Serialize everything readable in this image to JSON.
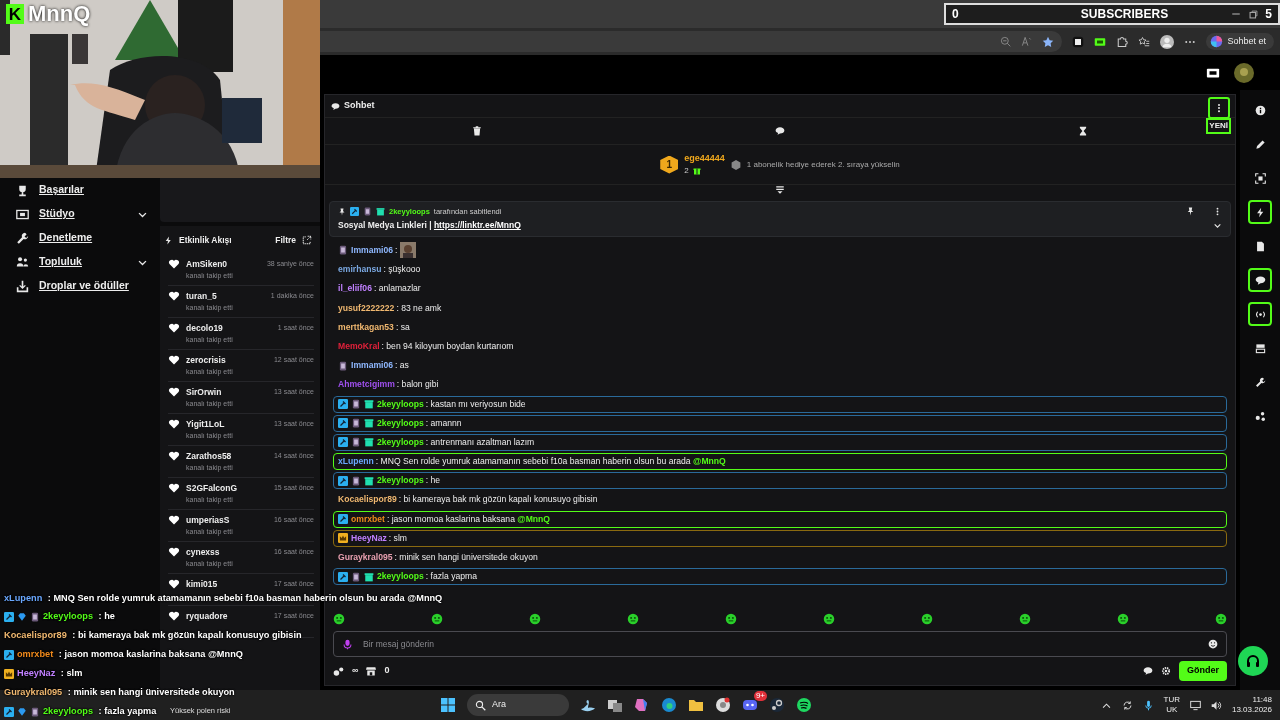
{
  "stream_overlay": {
    "logo_letter": "K",
    "channel": "MnnQ",
    "subscribers": {
      "current": "0",
      "label": "SUBSCRIBERS",
      "goal": "5"
    }
  },
  "browser": {
    "copilot_label": "Sohbet et"
  },
  "sidebar": {
    "items": [
      {
        "label": "Başarılar",
        "expandable": false
      },
      {
        "label": "Stüdyo",
        "expandable": true
      },
      {
        "label": "Denetleme",
        "expandable": false
      },
      {
        "label": "Topluluk",
        "expandable": true
      },
      {
        "label": "Droplar ve ödüller",
        "expandable": false
      }
    ]
  },
  "activity_feed": {
    "title": "Etkinlik Akışı",
    "filter_label": "Filtre",
    "events": [
      {
        "user": "AmSiken0",
        "time": "38 saniye önce",
        "action": "kanalı takip etti"
      },
      {
        "user": "turan_5",
        "time": "1 dakika önce",
        "action": "kanalı takip etti"
      },
      {
        "user": "decolo19",
        "time": "1 saat önce",
        "action": "kanalı takip etti"
      },
      {
        "user": "zerocrisis",
        "time": "12 saat önce",
        "action": "kanalı takip etti"
      },
      {
        "user": "SirOrwin",
        "time": "13 saat önce",
        "action": "kanalı takip etti"
      },
      {
        "user": "Yigit1LoL",
        "time": "13 saat önce",
        "action": "kanalı takip etti"
      },
      {
        "user": "Zarathos58",
        "time": "14 saat önce",
        "action": "kanalı takip etti"
      },
      {
        "user": "S2GFalconG",
        "time": "15 saat önce",
        "action": "kanalı takip etti"
      },
      {
        "user": "umperiasS",
        "time": "16 saat önce",
        "action": "kanalı takip etti"
      },
      {
        "user": "cynexss",
        "time": "16 saat önce",
        "action": "kanalı takip etti"
      },
      {
        "user": "kimi015",
        "time": "17 saat önce"
      },
      {
        "user": "ryquadore",
        "time": "17 saat önce"
      }
    ]
  },
  "chat": {
    "title": "Sohbet",
    "new_badge": "YENİ",
    "leaderboard": {
      "rank": "1",
      "user": "ege44444",
      "count": "2",
      "hint": "1 abonelik hediye ederek 2. sıraya yükselin"
    },
    "pinned": {
      "user": "2keyyloops",
      "by_text": "tarafından sabitlendi",
      "text": "Sosyal Medya Linkleri | ",
      "link": "https://linktr.ee/MnnQ"
    },
    "messages": [
      {
        "user": "Immami06",
        "color": "#8fb8ff",
        "text": ":",
        "kind": "emote"
      },
      {
        "user": "emirhansu",
        "color": "#7aa7e0",
        "text": ": şüşkooo",
        "kind": "plain"
      },
      {
        "user": "il_eliif06",
        "color": "#c080ff",
        "text": ": anlamazlar",
        "kind": "plain"
      },
      {
        "user": "yusuf2222222",
        "color": "#f0b870",
        "text": ": 83 ne amk",
        "kind": "plain"
      },
      {
        "user": "merttkagan53",
        "color": "#f0b870",
        "text": ": sa",
        "kind": "plain"
      },
      {
        "user": "MemoKral",
        "color": "#e0203a",
        "text": ": ben 94 kiloyum boydan kurtarıom",
        "kind": "plain"
      },
      {
        "user": "Immami06",
        "color": "#8fb8ff",
        "text": ": as",
        "kind": "member"
      },
      {
        "user": "Ahmetcigimm",
        "color": "#a050f0",
        "text": ": balon gibi",
        "kind": "plain"
      },
      {
        "user": "2keyyloops",
        "color": "#53fc18",
        "text": ": kastan mı veriyosun bide",
        "kind": "moderator"
      },
      {
        "user": "2keyyloops",
        "color": "#53fc18",
        "text": ": amannn",
        "kind": "moderator"
      },
      {
        "user": "2keyyloops",
        "color": "#53fc18",
        "text": ": antrenmanı azaltman lazım",
        "kind": "moderator"
      },
      {
        "user": "xLupenn",
        "color": "#6aa8ff",
        "text": ": MNQ Sen rolde yumruk atamamanın sebebi f10a basman haberin olsun bu arada ",
        "mention": "@MnnQ",
        "kind": "mention"
      },
      {
        "user": "2keyyloops",
        "color": "#53fc18",
        "text": ": he",
        "kind": "moderator"
      },
      {
        "user": "Kocaelispor89",
        "color": "#f0b870",
        "text": ": bi kameraya bak mk gözün kapalı konusuyo gibisin",
        "kind": "plain"
      },
      {
        "user": "omrxbet",
        "color": "#f08a1c",
        "text": ": jason momoa kaslarina baksana ",
        "mention": "@MnnQ",
        "kind": "modmention"
      },
      {
        "user": "HeeyNaz",
        "color": "#c080ff",
        "text": ": slm",
        "kind": "vip"
      },
      {
        "user": "Guraykral095",
        "color": "#e8a0b0",
        "text": ": minik sen hangi üniversitede okuyon",
        "kind": "plain"
      },
      {
        "user": "2keyyloops",
        "color": "#53fc18",
        "text": ": fazla yapma",
        "kind": "moderator"
      }
    ],
    "input": {
      "placeholder": "Bir mesaj gönderin"
    },
    "footer": {
      "points": "∞",
      "store_count": "0",
      "send_label": "Gönder"
    }
  },
  "overlay_chat": [
    {
      "user": "xLupenn",
      "color": "#6aa8ff",
      "text": " : MNQ Sen rolde yumruk atamamanın sebebi f10a basman haberin olsun bu arada @MnnQ",
      "kind": "plain"
    },
    {
      "user": "2keyyloops",
      "color": "#53fc18",
      "text": " : he",
      "kind": "moderator"
    },
    {
      "user": "Kocaelispor89",
      "color": "#f0b870",
      "text": " : bi kameraya bak mk gözün kapalı konusuyo gibisin",
      "kind": "plain"
    },
    {
      "user": "omrxbet",
      "color": "#f08a1c",
      "text": " : jason momoa kaslarina baksana @MnnQ",
      "kind": "sword"
    },
    {
      "user": "HeeyNaz",
      "color": "#c080ff",
      "text": " : slm",
      "kind": "crown"
    },
    {
      "user": "Guraykral095",
      "color": "#f0b870",
      "text": " : minik sen hangi üniversitede okuyon",
      "kind": "plain"
    },
    {
      "user": "2keyyloops",
      "color": "#53fc18",
      "text": " : fazla yapma",
      "kind": "moderator"
    }
  ],
  "taskbar": {
    "weather": "Yüksek polen riski",
    "search_label": "Ara",
    "language": "TUR",
    "layout": "UK",
    "time": "11:48",
    "date": "13.03.2026",
    "discord_badge": "9+"
  }
}
